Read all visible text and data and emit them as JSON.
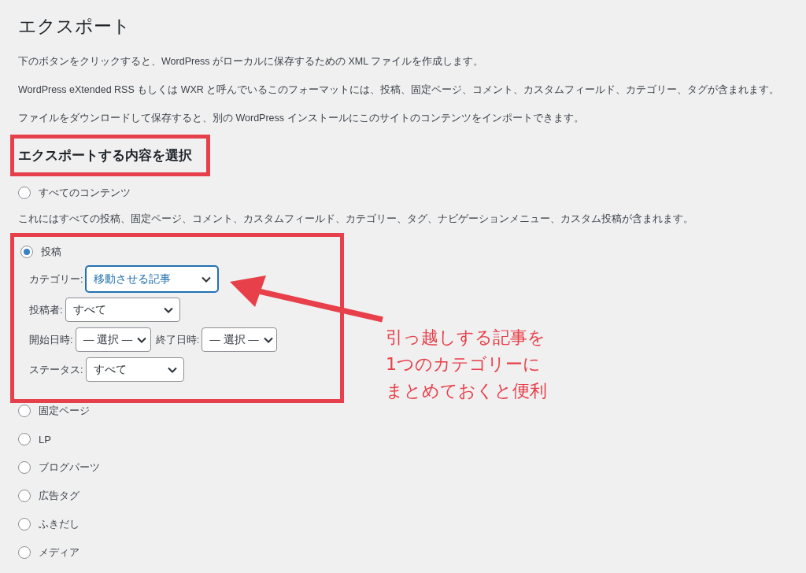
{
  "page": {
    "title": "エクスポート"
  },
  "intro": [
    "下のボタンをクリックすると、WordPress がローカルに保存するための XML ファイルを作成します。",
    "WordPress eXtended RSS もしくは WXR と呼んでいるこのフォーマットには、投稿、固定ページ、コメント、カスタムフィールド、カテゴリー、タグが含まれます。",
    "ファイルをダウンロードして保存すると、別の WordPress インストールにこのサイトのコンテンツをインポートできます。"
  ],
  "section_heading": "エクスポートする内容を選択",
  "options": [
    {
      "label": "すべてのコンテンツ",
      "selected": false,
      "description": "これにはすべての投稿、固定ページ、コメント、カスタムフィールド、カテゴリー、タグ、ナビゲーションメニュー、カスタム投稿が含まれます。"
    },
    {
      "label": "投稿",
      "selected": true,
      "filter_rows": [
        {
          "fields": [
            {
              "label": "カテゴリー:",
              "value": "移動させる記事",
              "focused": true
            }
          ]
        },
        {
          "fields": [
            {
              "label": "投稿者:",
              "value": "すべて",
              "focused": false
            }
          ]
        },
        {
          "fields": [
            {
              "label": "開始日時:",
              "value": "— 選択 —",
              "focused": false
            },
            {
              "label": "終了日時:",
              "value": "— 選択 —",
              "focused": false
            }
          ]
        },
        {
          "fields": [
            {
              "label": "ステータス:",
              "value": "すべて",
              "focused": false
            }
          ]
        }
      ]
    },
    {
      "label": "固定ページ",
      "selected": false
    },
    {
      "label": "LP",
      "selected": false
    },
    {
      "label": "ブログパーツ",
      "selected": false
    },
    {
      "label": "広告タグ",
      "selected": false
    },
    {
      "label": "ふきだし",
      "selected": false
    },
    {
      "label": "メディア",
      "selected": false
    }
  ],
  "annotation": {
    "lines": [
      "引っ越しする記事を",
      "1つのカテゴリーに",
      "まとめておくと便利"
    ]
  }
}
